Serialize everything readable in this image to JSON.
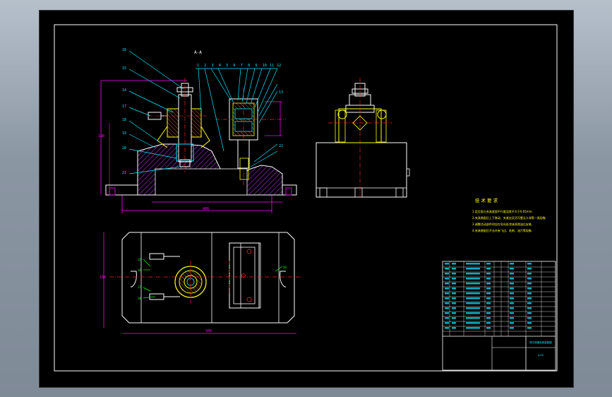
{
  "drawing": {
    "section_label": "A-A",
    "balloons_left": [
      "16",
      "15",
      "14",
      "17",
      "18",
      "19",
      "20",
      "21"
    ],
    "balloons_top": [
      "1",
      "2",
      "3",
      "4",
      "5",
      "6",
      "7",
      "8",
      "9",
      "10",
      "11",
      "12"
    ],
    "balloons_right": [
      "13",
      "22"
    ],
    "tech_req": {
      "title": "技 术 要 求",
      "lines": [
        "1.定位面与夹具底面平行度误差不大于0.05mm.",
        "2.夹具装配后上下移动、夹紧应灵活可靠无卡滞等一类现象.",
        "3.调整活动部件时应在导向处涂抹润滑油后安装.",
        "4.夹具装配后不允许有飞边、毛刺、油污等现象."
      ]
    },
    "title_block": {
      "drawing_name": "拨叉铣槽夹具装配图",
      "drawing_no": "JJ-00"
    }
  },
  "colors": {
    "background": "#000000",
    "frame": "#ffffff",
    "cyan": "#00e5ff",
    "magenta": "#ff00ff",
    "yellow": "#ffff00",
    "green": "#00ff00",
    "red": "#ff2020",
    "hatch": "#a020d0",
    "desktop": "#8e99a6"
  }
}
